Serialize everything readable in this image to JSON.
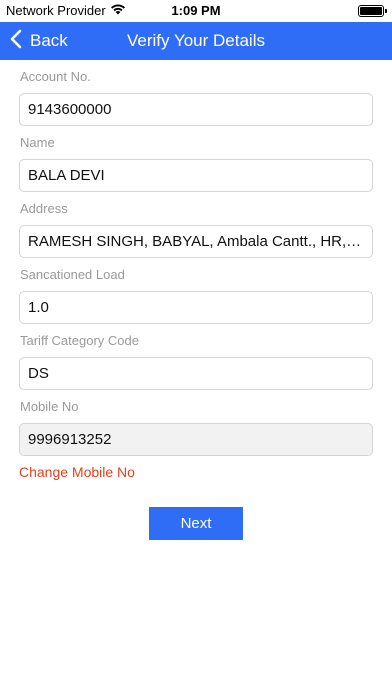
{
  "status_bar": {
    "carrier": "Network Provider",
    "time": "1:09 PM"
  },
  "nav": {
    "back_label": "Back",
    "title": "Verify Your Details"
  },
  "fields": [
    {
      "label": "Account No.",
      "value": "9143600000"
    },
    {
      "label": "Name",
      "value": "BALA DEVI"
    },
    {
      "label": "Address",
      "value": "RAMESH SINGH, BABYAL, Ambala Cantt., HR, I..."
    },
    {
      "label": "Sancationed Load",
      "value": "1.0"
    },
    {
      "label": "Tariff Category Code",
      "value": "DS"
    },
    {
      "label": "Mobile No",
      "value": "9996913252"
    }
  ],
  "change_mobile_label": "Change Mobile No",
  "next_label": "Next",
  "colors": {
    "accent": "#2f6df6",
    "link": "#e8401c",
    "label": "#9a9a9a"
  }
}
